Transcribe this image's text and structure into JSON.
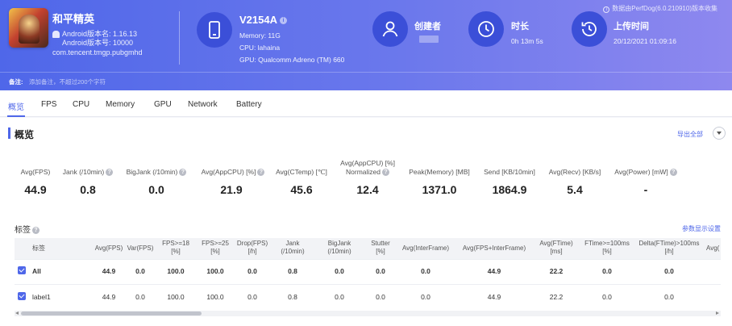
{
  "app": {
    "name": "和平精英",
    "android_version_name": "Android版本名: 1.16.13",
    "android_version_code": "Android版本号: 10000",
    "package": "com.tencent.tmgp.pubgmhd"
  },
  "device": {
    "name": "V2154A",
    "memory": "Memory: 11G",
    "cpu": "CPU: lahaina",
    "gpu": "GPU: Qualcomm Adreno (TM) 660"
  },
  "creator": {
    "title": "创建者",
    "value": ""
  },
  "duration": {
    "title": "时长",
    "value": "0h 13m 5s"
  },
  "upload": {
    "title": "上传时间",
    "value": "20/12/2021 01:09:16"
  },
  "perfdog_note": "数据由PerfDog(6.0.210910)版本收集",
  "note": {
    "label": "备注:",
    "placeholder": "添加备注，不超过200个字符"
  },
  "tabs": [
    "概览",
    "FPS",
    "CPU",
    "Memory",
    "GPU",
    "Network",
    "Battery"
  ],
  "section": {
    "title": "概览",
    "export_label": "导出全部"
  },
  "metrics": [
    {
      "label": "Avg(FPS)",
      "help": false,
      "value": "44.9"
    },
    {
      "label": "Jank (/10min)",
      "help": true,
      "value": "0.8"
    },
    {
      "label": "BigJank (/10min)",
      "help": true,
      "value": "0.0"
    },
    {
      "label": "Avg(AppCPU) [%]",
      "help": true,
      "value": "21.9"
    },
    {
      "label": "Avg(CTemp) [℃]",
      "help": false,
      "value": "45.6"
    },
    {
      "label": "Avg(AppCPU) [%]",
      "label2": "Normalized",
      "help": true,
      "value": "12.4"
    },
    {
      "label": "Peak(Memory) [MB]",
      "help": false,
      "value": "1371.0"
    },
    {
      "label": "Send [KB/10min]",
      "help": false,
      "value": "1864.9"
    },
    {
      "label": "Avg(Recv) [KB/s]",
      "help": false,
      "value": "5.4"
    },
    {
      "label": "Avg(Power) [mW]",
      "help": true,
      "value": "-"
    }
  ],
  "tags": {
    "title": "标签",
    "param_settings_label": "参数显示设置"
  },
  "table": {
    "columns": [
      [
        "标签"
      ],
      [
        "Avg(FPS)"
      ],
      [
        "Var(FPS)"
      ],
      [
        "FPS>=18",
        "[%]"
      ],
      [
        "FPS>=25",
        "[%]"
      ],
      [
        "Drop(FPS)",
        "[/h]"
      ],
      [
        "Jank",
        "(/10min)"
      ],
      [
        "BigJank",
        "(/10min)"
      ],
      [
        "Stutter",
        "[%]"
      ],
      [
        "Avg(InterFrame)"
      ],
      [
        "Avg(FPS+InterFrame)"
      ],
      [
        "Avg(FTime)",
        "[ms]"
      ],
      [
        "FTime>=100ms",
        "[%]"
      ],
      [
        "Delta(FTime)>100ms",
        "[/h]"
      ],
      [
        "Avg("
      ]
    ],
    "rows": [
      {
        "name": "All",
        "cells": [
          "44.9",
          "0.0",
          "100.0",
          "100.0",
          "0.0",
          "0.8",
          "0.0",
          "0.0",
          "0.0",
          "44.9",
          "22.2",
          "0.0",
          "0.0"
        ]
      },
      {
        "name": "label1",
        "cells": [
          "44.9",
          "0.0",
          "100.0",
          "100.0",
          "0.0",
          "0.8",
          "0.0",
          "0.0",
          "0.0",
          "44.9",
          "22.2",
          "0.0",
          "0.0"
        ]
      }
    ]
  }
}
